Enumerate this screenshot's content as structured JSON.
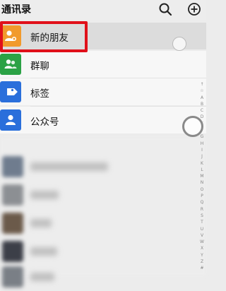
{
  "header": {
    "title": "通讯录",
    "search_icon": "search-icon",
    "add_icon": "plus-circle-icon"
  },
  "rows": [
    {
      "label": "新的朋友",
      "icon": "person-add-icon",
      "color": "#f19a2c"
    },
    {
      "label": "群聊",
      "icon": "group-icon",
      "color": "#2ba245"
    },
    {
      "label": "标签",
      "icon": "tag-icon",
      "color": "#2a6fdb"
    },
    {
      "label": "公众号",
      "icon": "person-icon",
      "color": "#2a6fdb"
    }
  ],
  "index_letters": [
    "↑",
    "☆",
    "A",
    "B",
    "C",
    "D",
    "E",
    "F",
    "G",
    "H",
    "I",
    "J",
    "K",
    "L",
    "M",
    "N",
    "O",
    "P",
    "Q",
    "R",
    "S",
    "T",
    "U",
    "V",
    "W",
    "X",
    "Y",
    "Z",
    "#"
  ],
  "highlight_color": "#e0101a"
}
